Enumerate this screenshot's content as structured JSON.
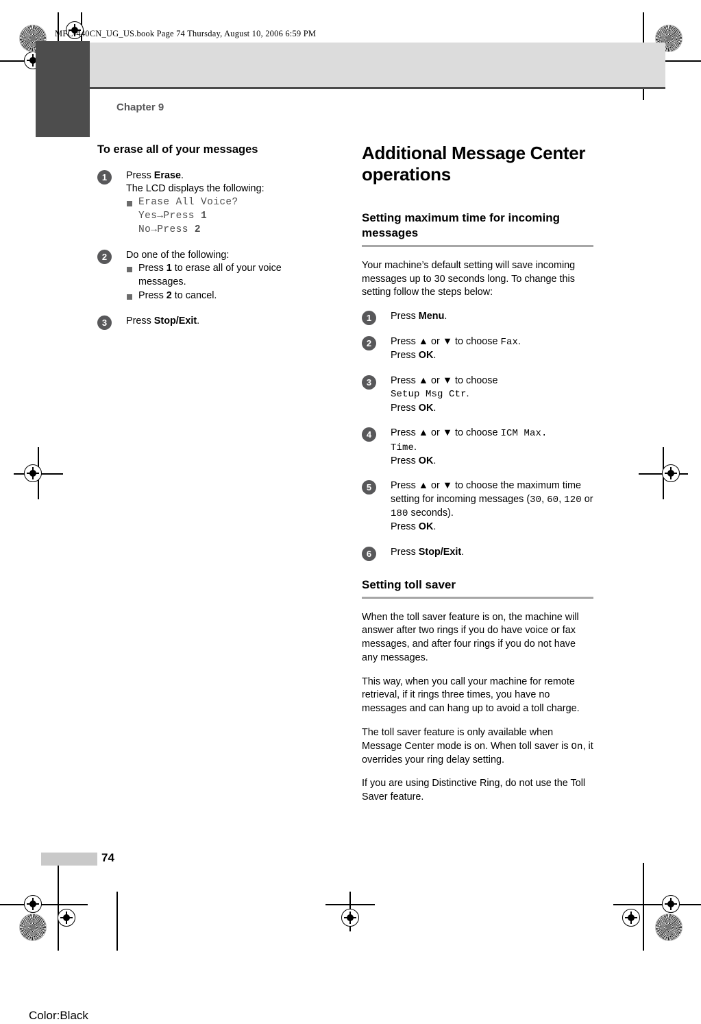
{
  "print_marks": {
    "book_header": "MFC-440CN_UG_US.book  Page 74  Thursday, August 10, 2006  6:59 PM",
    "color_note": "Color:Black"
  },
  "page": {
    "chapter_label": "Chapter 9",
    "page_number": "74"
  },
  "left_column": {
    "heading": "To erase all of your messages",
    "steps": [
      {
        "num": "1",
        "lines": [
          {
            "type": "text",
            "html": "Press <b>Erase</b>."
          },
          {
            "type": "text",
            "html": "The LCD displays the following:"
          },
          {
            "type": "bullet-lcd",
            "html": "Erase All Voice?"
          },
          {
            "type": "lcd-indent",
            "html": "Yes→Press <b>1</b>"
          },
          {
            "type": "lcd-indent",
            "html": "No→Press <b>2</b>"
          }
        ]
      },
      {
        "num": "2",
        "lines": [
          {
            "type": "text",
            "html": "Do one of the following:"
          },
          {
            "type": "bullet",
            "html": "Press <b>1</b> to erase all of your voice messages."
          },
          {
            "type": "bullet",
            "html": "Press <b>2</b> to cancel."
          }
        ]
      },
      {
        "num": "3",
        "lines": [
          {
            "type": "text",
            "html": "Press <b>Stop/Exit</b>."
          }
        ]
      }
    ]
  },
  "right_column": {
    "main_heading": "Additional Message Center operations",
    "section_icm": {
      "heading": "Setting maximum time for incoming messages",
      "intro": "Your machine’s default setting will save incoming messages up to 30 seconds long. To change this setting follow the steps below:",
      "steps": [
        {
          "num": "1",
          "lines": [
            {
              "type": "text",
              "html": "Press <b>Menu</b>."
            }
          ]
        },
        {
          "num": "2",
          "lines": [
            {
              "type": "text",
              "html": "Press ▲ or ▼ to choose <span class=\"mono\">Fax</span>."
            },
            {
              "type": "text",
              "html": "Press <b>OK</b>."
            }
          ]
        },
        {
          "num": "3",
          "lines": [
            {
              "type": "text",
              "html": "Press ▲ or ▼ to choose"
            },
            {
              "type": "text",
              "html": "<span class=\"mono\">Setup Msg Ctr</span>."
            },
            {
              "type": "text",
              "html": "Press <b>OK</b>."
            }
          ]
        },
        {
          "num": "4",
          "lines": [
            {
              "type": "text",
              "html": "Press ▲ or ▼ to choose <span class=\"mono\">ICM Max.</span>"
            },
            {
              "type": "text",
              "html": "<span class=\"mono\">Time</span>."
            },
            {
              "type": "text",
              "html": "Press <b>OK</b>."
            }
          ]
        },
        {
          "num": "5",
          "lines": [
            {
              "type": "text",
              "html": "Press ▲ or ▼ to choose the maximum time setting for incoming messages (<span class=\"mono\">30</span>, <span class=\"mono\">60</span>, <span class=\"mono\">120</span> or <span class=\"mono\">180</span> seconds)."
            },
            {
              "type": "text",
              "html": "Press <b>OK</b>."
            }
          ]
        },
        {
          "num": "6",
          "lines": [
            {
              "type": "text",
              "html": "Press <b>Stop/Exit</b>."
            }
          ]
        }
      ]
    },
    "section_toll": {
      "heading": "Setting toll saver",
      "paragraphs": [
        "When the toll saver feature is on, the machine will answer after two rings if you do have voice or fax messages, and after four rings if you do not have any messages.",
        "This way, when you call your machine for remote retrieval, if it rings three times, you have no messages and can hang up to avoid a toll charge.",
        "The toll saver feature is only available when Message Center mode is on. When toll saver is <span class=\"mono\">On</span>, it overrides your ring delay setting.",
        "If you are using Distinctive Ring, do not use the Toll Saver feature."
      ]
    }
  }
}
